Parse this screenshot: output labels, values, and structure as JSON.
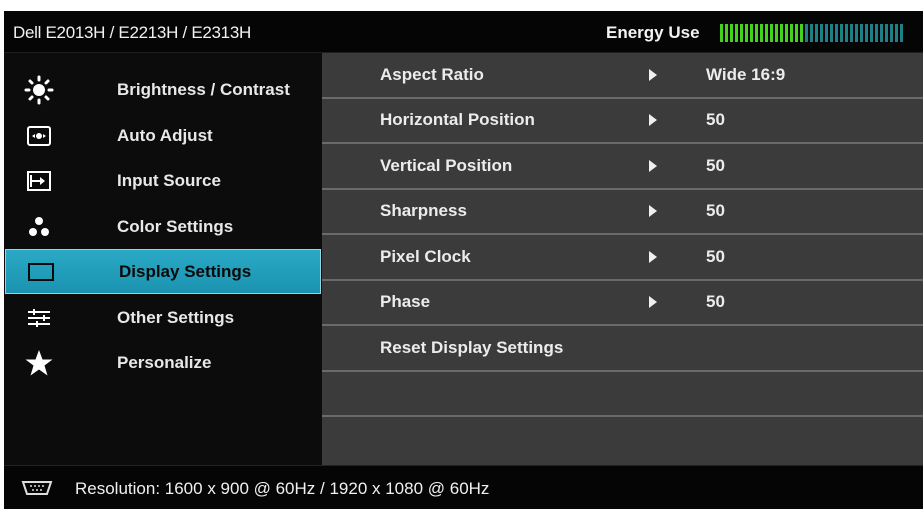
{
  "header": {
    "title": "Dell E2013H / E2213H / E2313H",
    "energy_label": "Energy Use",
    "energy_level": 0.45,
    "energy_active_color": "#43d31d",
    "energy_inactive_color": "#1f7f86"
  },
  "menu": {
    "selected_index": 4,
    "items": [
      {
        "label": "Brightness / Contrast",
        "icon": "brightness-icon"
      },
      {
        "label": "Auto Adjust",
        "icon": "auto-adjust-icon"
      },
      {
        "label": "Input Source",
        "icon": "input-source-icon"
      },
      {
        "label": "Color Settings",
        "icon": "color-settings-icon"
      },
      {
        "label": "Display Settings",
        "icon": "display-settings-icon"
      },
      {
        "label": "Other Settings",
        "icon": "other-settings-icon"
      },
      {
        "label": "Personalize",
        "icon": "star-icon"
      }
    ]
  },
  "panel": {
    "rows": [
      {
        "label": "Aspect Ratio",
        "value": "Wide  16:9",
        "has_arrow": true
      },
      {
        "label": "Horizontal Position",
        "value": "50",
        "has_arrow": true
      },
      {
        "label": "Vertical Position",
        "value": "50",
        "has_arrow": true
      },
      {
        "label": "Sharpness",
        "value": "50",
        "has_arrow": true
      },
      {
        "label": "Pixel Clock",
        "value": "50",
        "has_arrow": true
      },
      {
        "label": "Phase",
        "value": "50",
        "has_arrow": true
      },
      {
        "label": "Reset Display Settings",
        "value": "",
        "has_arrow": false
      },
      {
        "label": "",
        "value": "",
        "has_arrow": false
      },
      {
        "label": "",
        "value": "",
        "has_arrow": false
      }
    ]
  },
  "footer": {
    "icon": "vga-connector-icon",
    "resolution_text": "Resolution:  1600 x 900 @ 60Hz / 1920 x 1080 @ 60Hz"
  },
  "colors": {
    "selected_bg": "#1f9fbd",
    "panel_bg": "#3b3b3b",
    "osd_bg": "#0c0c0c"
  }
}
